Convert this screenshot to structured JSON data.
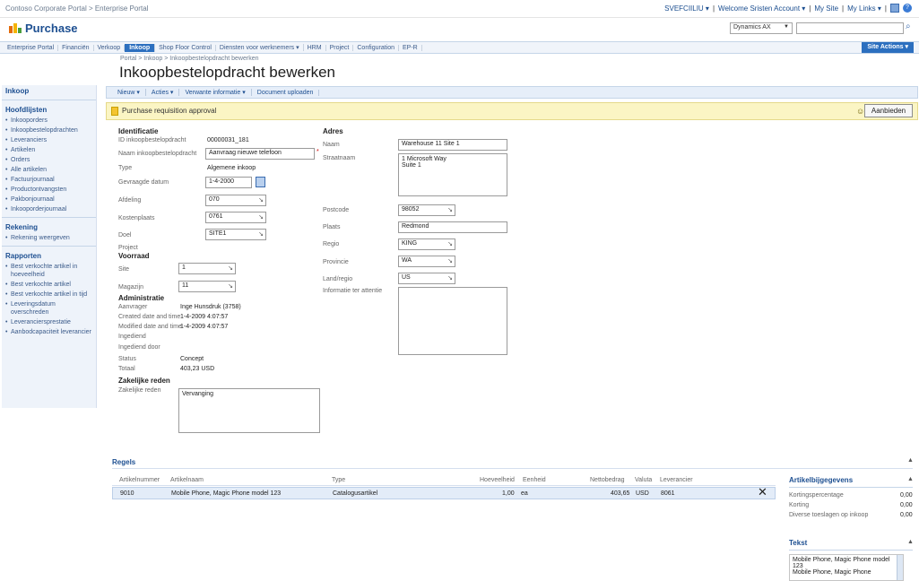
{
  "topbar": {
    "breadcrumb": "Contoso Corporate Portal > Enterprise Portal",
    "links": [
      "SVEFCIILIU ▾",
      "Welcome Sristen Account ▾",
      "My Site",
      "My Links ▾"
    ]
  },
  "site": {
    "title": "Purchase",
    "scope": "Dynamics AX",
    "search_placeholder": ""
  },
  "nav": {
    "items": [
      "Enterprise Portal",
      "Financiën",
      "Verkoop",
      "Inkoop",
      "Shop Floor Control",
      "Diensten voor werknemers ▾",
      "HRM",
      "Project",
      "Configuration",
      "EP-R"
    ],
    "active_index": 3,
    "site_actions": "Site Actions ▾"
  },
  "page": {
    "breadcrumb": "Portal > Inkoop > Inkoopbestelopdracht bewerken",
    "title": "Inkoopbestelopdracht bewerken"
  },
  "leftnav": {
    "sections": [
      {
        "title": "Inkoop",
        "items": []
      },
      {
        "title": "Hoofdlijsten",
        "items": [
          "Inkooporders",
          "Inkoopbestelopdrachten",
          "Leveranciers",
          "Artikelen",
          "Orders",
          "Alle artikelen",
          "Factuurjournaal",
          "Productontvangsten",
          "Pakbonjournaal",
          "Inkooporderjournaal"
        ]
      },
      {
        "title": "Rekening",
        "items": [
          "Rekening weergeven"
        ]
      },
      {
        "title": "Rapporten",
        "items": [
          "Best verkochte artikel in hoeveelheid",
          "Best verkochte artikel",
          "Best verkochte artikel in tijd",
          "Leveringsdatum overschreden",
          "Leveranciersprestatie",
          "Aanbodcapaciteit leverancier"
        ]
      }
    ]
  },
  "toolbar": {
    "items": [
      "Nieuw ▾",
      "Acties ▾",
      "Verwante informatie ▾",
      "Document uploaden"
    ]
  },
  "workflow": {
    "text": "Purchase requisition approval",
    "button": "Aanbieden"
  },
  "identification": {
    "section": "Identificatie",
    "labels": {
      "id": "ID inkoopbestelopdracht",
      "name": "Naam inkoopbestelopdracht",
      "type": "Type",
      "date": "Gevraagde datum",
      "dept": "Afdeling",
      "costcenter": "Kostenplaats",
      "purpose": "Doel",
      "project": "Project"
    },
    "values": {
      "id": "00000031_181",
      "name": "Aanvraag nieuwe telefoon",
      "type": "Algemene inkoop",
      "date": "1-4-2000",
      "dept": "070",
      "costcenter": "0761",
      "purpose": "SITE1"
    }
  },
  "inventory": {
    "section": "Voorraad",
    "labels": {
      "site": "Site",
      "warehouse": "Magazijn"
    },
    "values": {
      "site": "1",
      "warehouse": "11"
    }
  },
  "administration": {
    "section": "Administratie",
    "labels": {
      "requester": "Aanvrager",
      "created": "Created date and time",
      "modified": "Modified date and time",
      "submitted": "Ingediend",
      "submitted_by": "Ingediend door",
      "status": "Status",
      "total": "Totaal"
    },
    "values": {
      "requester": "Inge Hunsdruk (3758)",
      "created": "1-4-2009 4:07:57",
      "modified": "1-4-2009 4:07:57",
      "status": "Concept",
      "total": "403,23 USD"
    }
  },
  "justification": {
    "section": "Zakelijke reden",
    "label": "Zakelijke reden",
    "value": "Vervanging"
  },
  "address": {
    "section": "Adres",
    "labels": {
      "name": "Naam",
      "street": "Straatnaam",
      "zip": "Postcode",
      "city": "Plaats",
      "region": "Regio",
      "state": "Provincie",
      "country": "Land/regio",
      "delivery": "Informatie ter attentie"
    },
    "values": {
      "name": "Warehouse 11 Site 1",
      "street": "1 Microsoft Way\nSuite 1",
      "zip": "98052",
      "city": "Redmond",
      "region": "KING",
      "state": "WA",
      "country": "US"
    }
  },
  "lines": {
    "title": "Regels",
    "headers": [
      "Artikelnummer",
      "Artikelnaam",
      "Type",
      "Hoeveelheid",
      "Eenheid",
      "Nettobedrag",
      "Valuta",
      "Leverancier"
    ],
    "rows": [
      {
        "item": "9010",
        "name": "Mobile Phone, Magic Phone model 123",
        "type": "Catalogusartikel",
        "qty": "1,00",
        "unit": "ea",
        "net": "403,65",
        "currency": "USD",
        "vendor": "8061"
      }
    ]
  },
  "discount_panel": {
    "title": "Artikelbijgegevens",
    "rows": [
      {
        "label": "Kortingspercentage",
        "value": "0,00"
      },
      {
        "label": "Korting",
        "value": "0,00"
      },
      {
        "label": "Diverse toeslagen op inkoop",
        "value": "0,00"
      }
    ]
  },
  "text_panel": {
    "title": "Tekst",
    "value": "Mobile Phone, Magic Phone model 123\nMobile Phone, Magic Phone"
  }
}
